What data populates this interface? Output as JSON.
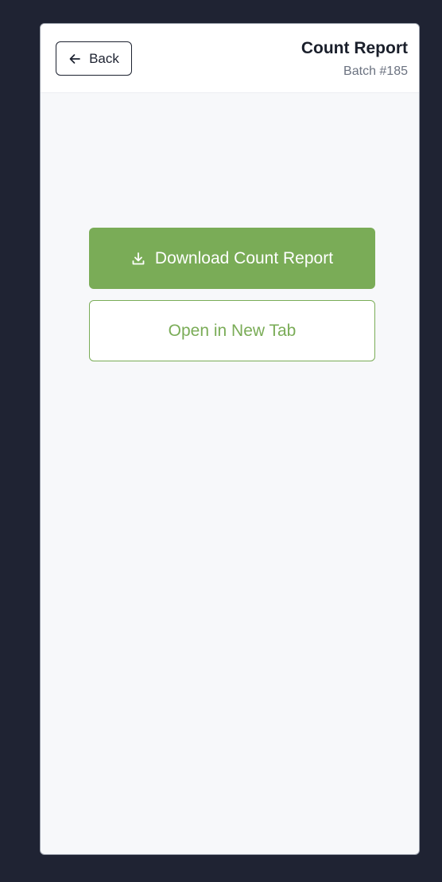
{
  "header": {
    "back_label": "Back",
    "title": "Count Report",
    "subtitle": "Batch #185"
  },
  "actions": {
    "download_label": "Download Count Report",
    "open_label": "Open in New Tab"
  },
  "icons": {
    "back": "arrow-left-icon",
    "download": "download-icon"
  },
  "colors": {
    "background": "#1f2333",
    "accent": "#7aac57",
    "text_dark": "#1a1f2b",
    "text_muted": "#6b7280"
  }
}
